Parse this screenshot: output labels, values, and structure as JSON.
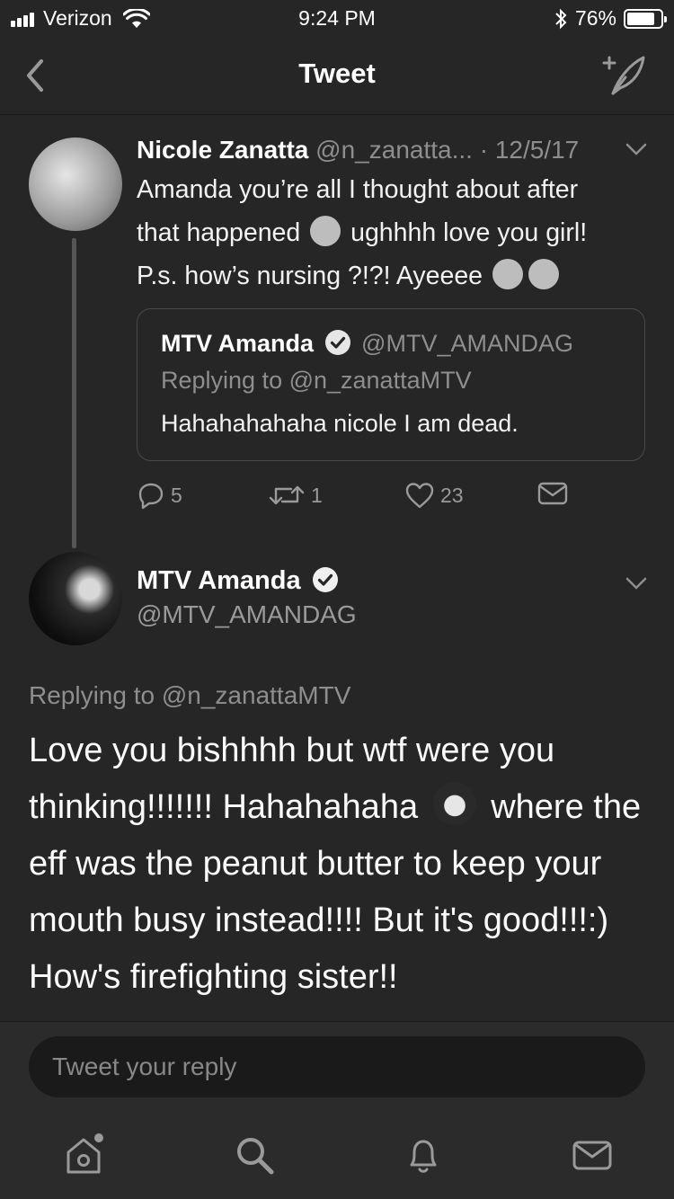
{
  "status_bar": {
    "carrier": "Verizon",
    "time": "9:24 PM",
    "battery": "76%"
  },
  "nav": {
    "title": "Tweet"
  },
  "thread_tweet": {
    "author_name": "Nicole Zanatta",
    "author_handle": "@n_zanatta...",
    "date": "· 12/5/17",
    "line1": "Amanda you’re all I thought about after",
    "line2a": "that happened",
    "line2b": "ughhhh love you girl!",
    "line3": "P.s. how’s nursing ?!?! Ayeeee",
    "quote": {
      "name": "MTV Amanda",
      "handle": "@MTV_AMANDAG",
      "replying_to": "Replying to @n_zanattaMTV",
      "text": "Hahahahahaha nicole I am dead."
    },
    "replies": "5",
    "retweets": "1",
    "likes": "23"
  },
  "main_tweet": {
    "author_name": "MTV Amanda",
    "author_handle": "@MTV_AMANDAG",
    "replying_to": "Replying to @n_zanattaMTV",
    "text_a": "Love you bishhhh but wtf were you thinking!!!!!!! Hahahahaha",
    "text_b": "where the eff was the peanut butter to keep your mouth busy instead!!!! But it's good!!!:) How's firefighting sister!!"
  },
  "reply_bar": {
    "placeholder": "Tweet your reply"
  },
  "tabs": [
    "home-icon",
    "search-icon",
    "notifications-icon",
    "messages-icon"
  ]
}
